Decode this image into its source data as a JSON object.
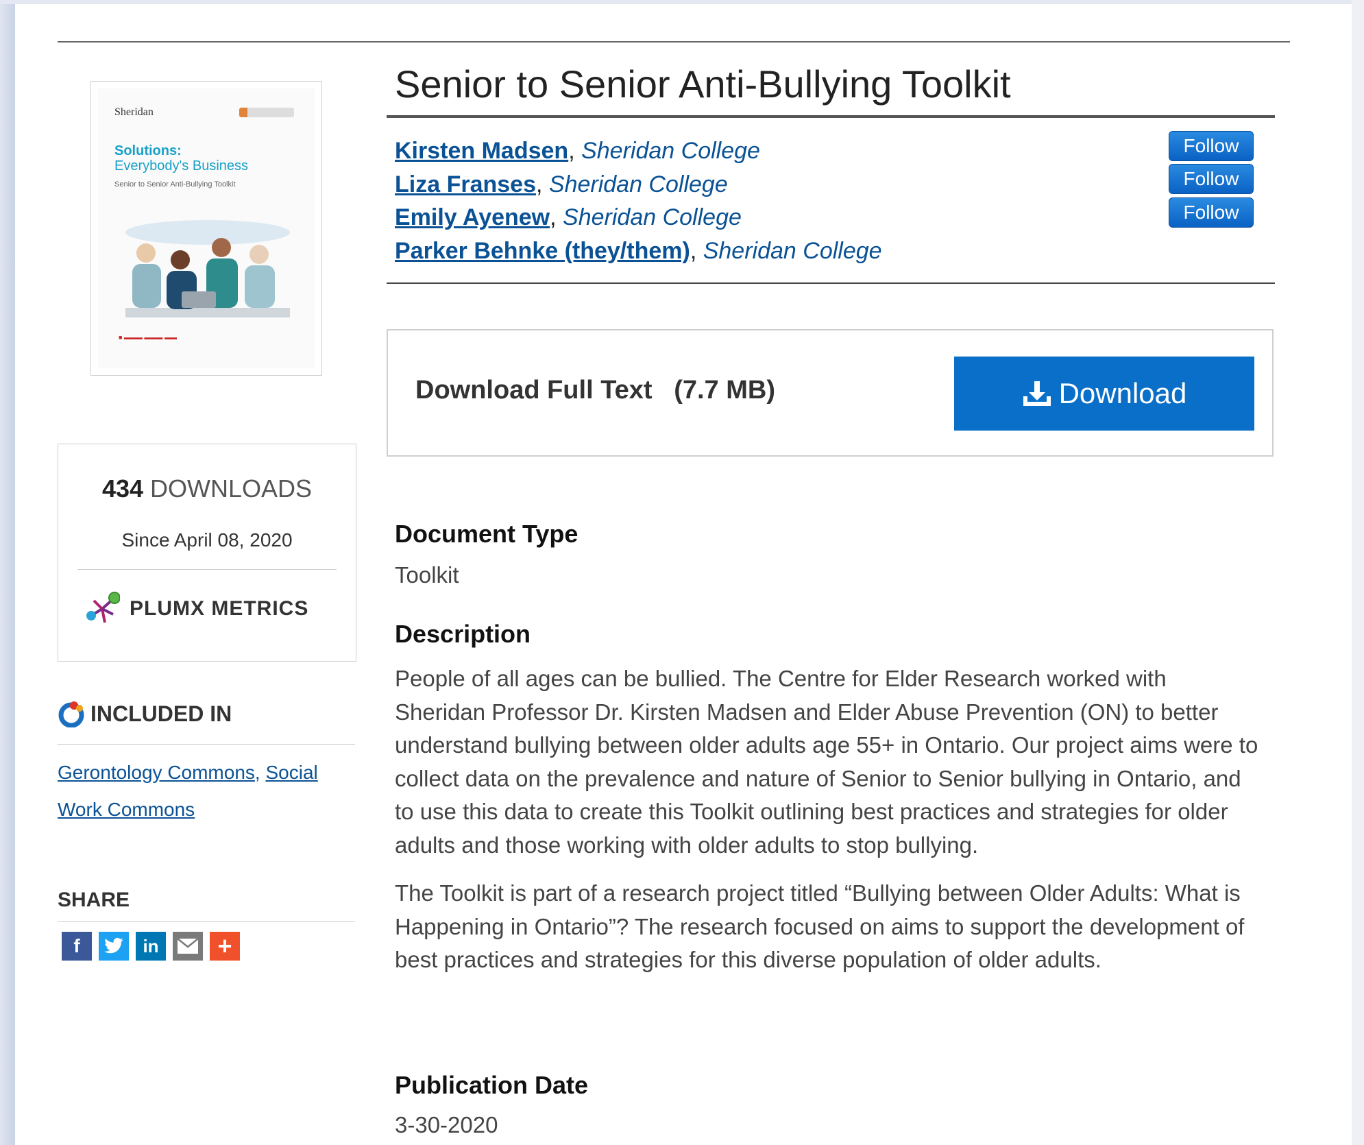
{
  "title": "Senior to Senior Anti-Bullying Toolkit",
  "authors": [
    {
      "name": "Kirsten Madsen",
      "affiliation": "Sheridan College",
      "follow": "Follow"
    },
    {
      "name": "Liza Franses",
      "affiliation": "Sheridan College",
      "follow": "Follow"
    },
    {
      "name": "Emily Ayenew",
      "affiliation": "Sheridan College",
      "follow": "Follow"
    },
    {
      "name": "Parker Behnke (they/them)",
      "affiliation": "Sheridan College"
    }
  ],
  "cover": {
    "logo": "Sheridan",
    "line1": "Solutions:",
    "line2": "Everybody's Business",
    "line3": "Senior to Senior Anti-Bullying Toolkit"
  },
  "download": {
    "label": "Download Full Text",
    "size": "(7.7 MB)",
    "button": "Download"
  },
  "stats": {
    "count": "434",
    "unit": "DOWNLOADS",
    "since": "Since April 08, 2020",
    "plumx": "PLUMX METRICS"
  },
  "included": {
    "heading": "INCLUDED IN",
    "link1": "Gerontology Commons",
    "link2a": "Social",
    "link2b": "Work Commons"
  },
  "share": {
    "heading": "SHARE",
    "icons": [
      "facebook-icon",
      "twitter-icon",
      "linkedin-icon",
      "email-icon",
      "more-icon"
    ]
  },
  "fields": {
    "doctype_h": "Document Type",
    "doctype_v": "Toolkit",
    "desc_h": "Description",
    "desc_p1": "People of all ages can be bullied. The Centre for Elder Research worked with Sheridan Professor Dr. Kirsten Madsen and Elder Abuse Prevention (ON) to better understand bullying between older adults age 55+ in Ontario. Our project aims were to collect data on the prevalence and nature of Senior to Senior bullying in Ontario, and to use this data to create this Toolkit outlining best practices and strategies for older adults and those working with older adults to stop bullying.",
    "desc_p2": "The Toolkit is part of a research project titled “Bullying between Older Adults: What is Happening in Ontario”? The research focused on aims to support the development of best practices and strategies for this diverse population of older adults.",
    "pubdate_h": "Publication Date",
    "pubdate_v": "3-30-2020"
  },
  "colors": {
    "link": "#0a5295",
    "button": "#0a6fc8",
    "follow": "#1a76d2"
  }
}
